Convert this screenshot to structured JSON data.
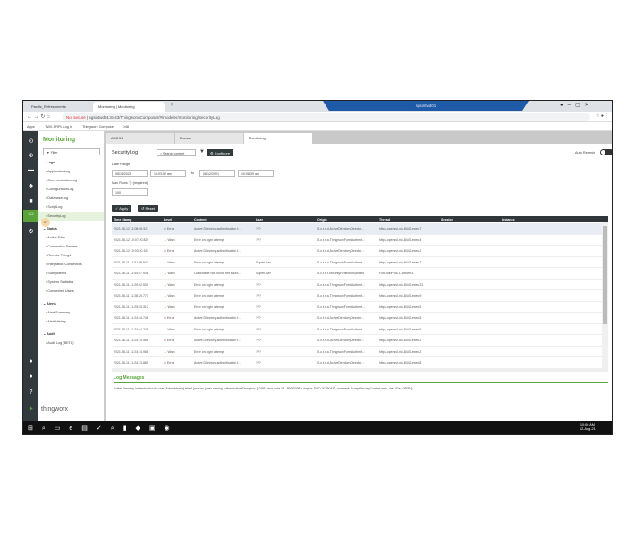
{
  "browser": {
    "tabs": [
      "Pacific_Refreshments",
      "Monitoring | Monitoring"
    ],
    "new_tab": "+",
    "not_secure": "Not secure",
    "url": "sgsintwd01:8443/Thingworx/Composer/#/modeler/monitoring/SecurityLog",
    "bookmarks": [
      "Apps",
      "TWX-PRPL Log in",
      "Thingworx Composer",
      "D48"
    ],
    "rdp_title": "sgsintwd01"
  },
  "nav": {
    "title": "Monitoring",
    "filter_placeholder": "Filter",
    "sections": [
      {
        "label": "Logs",
        "items": [
          "ApplicationLog",
          "CommunicationLog",
          "ConfigurationLog",
          "DatabaseLog",
          "ScriptLog",
          "SecurityLog"
        ]
      },
      {
        "label": "Status",
        "items": [
          "Active Edits",
          "Connection Servers",
          "Remote Things",
          "Integration Connectors",
          "Subsystems",
          "System Statistics",
          "Connected Users"
        ]
      },
      {
        "label": "Alerts",
        "items": [
          "Alert Summary",
          "Alert History"
        ]
      },
      {
        "label": "Audit",
        "items": [
          "Audit Log (BETA)"
        ]
      }
    ],
    "active": "SecurityLog",
    "brand": "thingworx",
    "badge": "KT"
  },
  "main": {
    "tabs": [
      "ADDS1",
      "Browse",
      "Monitoring"
    ],
    "title": "SecurityLog",
    "search_placeholder": "Search content",
    "configure": "Configure",
    "auto_refresh": "Auto Refresh",
    "date_range_label": "Date Range",
    "from_date": "08/11/2021",
    "from_time": "10:03:52 am",
    "to": "to",
    "to_date": "08/12/2021",
    "to_time": "10:08:39 am",
    "max_rows_label": "Max Rows",
    "required": "(required)",
    "max_rows": "100",
    "apply": "Apply",
    "reset": "Reset",
    "columns": [
      "Time Stamp",
      "Level",
      "Content",
      "User",
      "Origin",
      "Thread",
      "Session",
      "Instance"
    ],
    "rows": [
      [
        "2021-08-12 11:08:05.921",
        "Error",
        "Active Directory authentication f...",
        "???",
        "S.c.t.s.d.ActiveDirectoryDirector...",
        "https-openssl-nio-8443-exec-7"
      ],
      [
        "2021-08-12 10:07:20.829",
        "Warn",
        "Error on login attempt",
        "???",
        "S.c.t.s.a.ThingworxFormAuthent...",
        "https-openssl-nio-8443-exec-4"
      ],
      [
        "2021-08-12 10:03:20.193",
        "Error",
        "Active Directory authentication f...",
        "",
        "S.c.t.s.d.ActiveDirectoryDirector...",
        "https-openssl-nio-8443-exec-2"
      ],
      [
        "2021-08-11 11:51:08.847",
        "Warn",
        "Error on login attempt",
        "SuperUser",
        "S.c.t.s.a.ThingworxFormAuthent...",
        "https-openssl-nio-8443-exec-7"
      ],
      [
        "2021-08-11 11:44:07.936",
        "Warn",
        "Classname not found: net.sourc...",
        "SuperUser",
        "S.c.t.s.r.SecurityReflectionUtilities",
        "ForkJoinPool-1-worker-3"
      ],
      [
        "2021-08-11 11:29:02.531",
        "Warn",
        "Error on login attempt",
        "???",
        "S.c.t.s.a.ThingworxFormAuthent...",
        "https-openssl-nio-8443-exec-21"
      ],
      [
        "2021-08-11 11:28:29.773",
        "Warn",
        "Error on login attempt",
        "???",
        "S.c.t.s.a.ThingworxFormAuthent...",
        "https-openssl-nio-8443-exec-9"
      ],
      [
        "2021-08-11 11:25:03.312",
        "Warn",
        "Error on login attempt",
        "???",
        "S.c.t.s.a.ThingworxFormAuthent...",
        "https-openssl-nio-8443-exec-5"
      ],
      [
        "2021-08-11 11:24:44.748",
        "Error",
        "Active Directory authentication f...",
        "???",
        "S.c.t.s.d.ActiveDirectoryDirector...",
        "https-openssl-nio-8443-exec-5"
      ],
      [
        "2021-08-11 11:24:44.748",
        "Warn",
        "Error on login attempt",
        "???",
        "S.c.t.s.a.ThingworxFormAuthent...",
        "https-openssl-nio-8443-exec-5"
      ],
      [
        "2021-08-11 11:24:14.968",
        "Error",
        "Active Directory authentication f...",
        "???",
        "S.c.t.s.d.ActiveDirectoryDirector...",
        "https-openssl-nio-8443-exec-2"
      ],
      [
        "2021-08-11 11:24:14.968",
        "Warn",
        "Error on login attempt",
        "???",
        "S.c.t.s.a.ThingworxFormAuthent...",
        "https-openssl-nio-8443-exec-2"
      ],
      [
        "2021-08-11 11:24:13.881",
        "Error",
        "Active Directory authentication f...",
        "???",
        "S.c.t.s.d.ActiveDirectoryDirector...",
        "https-openssl-nio-8443-exec-8"
      ]
    ],
    "log_title": "Log Messages",
    "log_message": "Active Directory authentication for user [Administrator] failed: [reason: javax.naming.AuthenticationException: [LDAP: error code 49 - 80090308: LdapErr: DSID-0C090447, comment: AcceptSecurityContext error, data 52e, v3839 ]]"
  },
  "taskbar": {
    "time": "10:06 AM",
    "date": "12-Aug-21"
  },
  "colors": {
    "accent": "#5aa33a",
    "error": "#e04040",
    "warn": "#f0a020"
  }
}
